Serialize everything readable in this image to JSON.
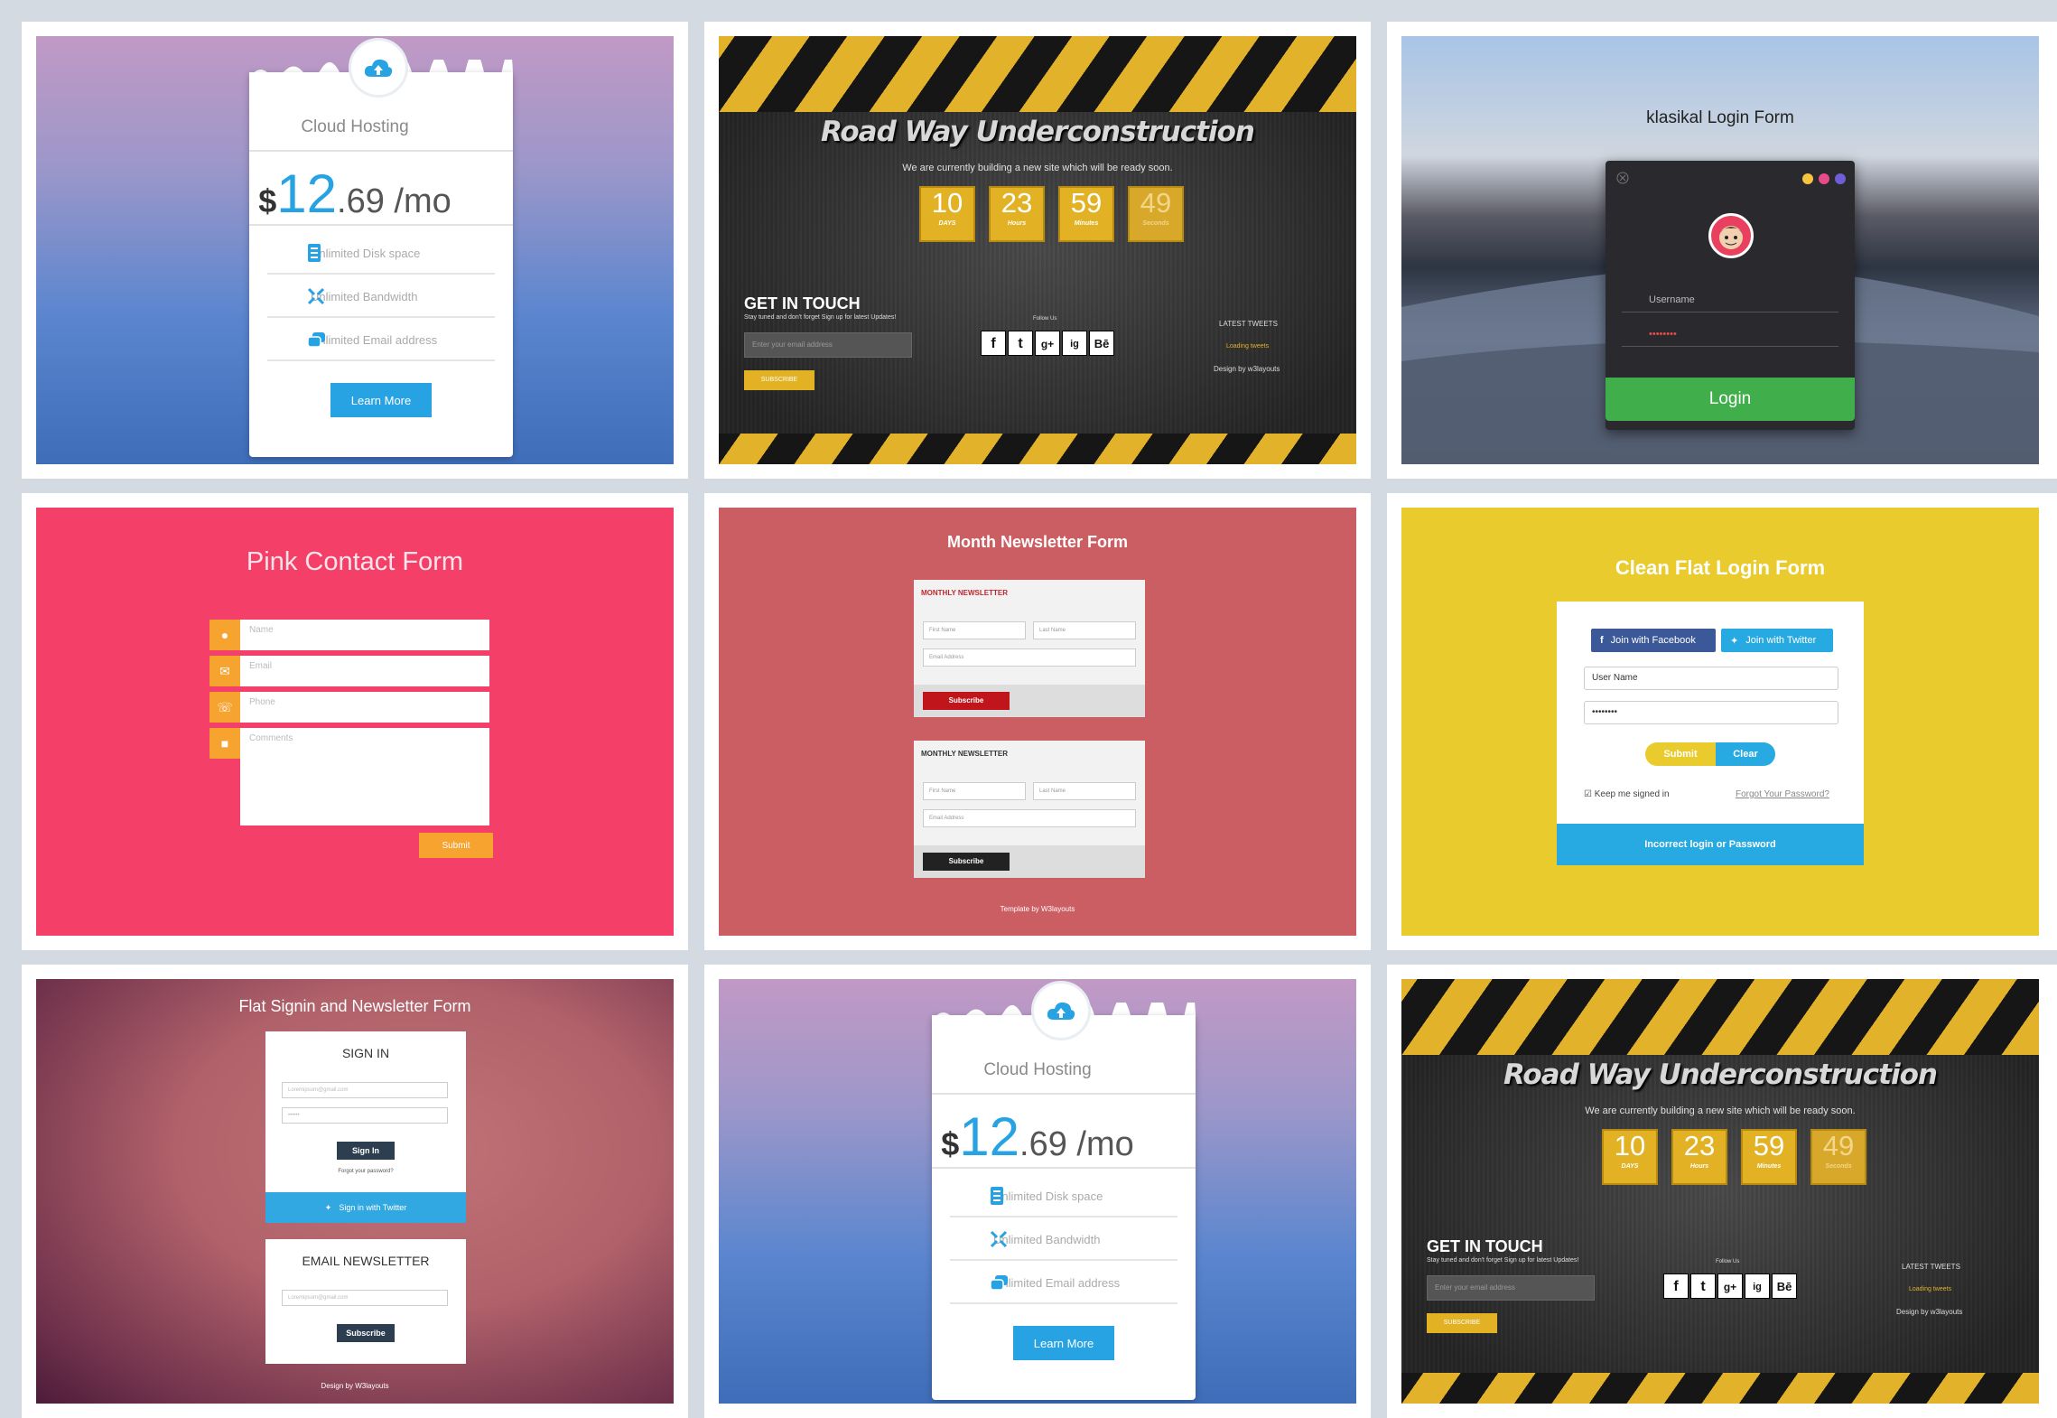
{
  "cloud_hosting": {
    "title": "Cloud Hosting",
    "price_currency": "$",
    "price_major": "12",
    "price_minor": ".69 /mo",
    "features": [
      "Unlimited Disk space",
      "Unlimited Bandwidth",
      "Unlimited Email address"
    ],
    "button": "Learn More",
    "accent": "#27a3e4"
  },
  "construction": {
    "title": "Road Way Underconstruction",
    "subtitle": "We are currently building a new site which will be ready soon.",
    "countdown": [
      {
        "value": "10",
        "label": "DAYS"
      },
      {
        "value": "23",
        "label": "Hours"
      },
      {
        "value": "59",
        "label": "Minutes"
      },
      {
        "value": "49",
        "label": "Seconds"
      }
    ],
    "get_in_touch": "GET IN TOUCH",
    "get_in_touch_sub": "Stay tuned and don't forget Sign up for latest Updates!",
    "email_placeholder": "Enter your email address",
    "subscribe": "SUBSCRIBE",
    "follow": "Follow Us",
    "social": [
      "f",
      "t",
      "g+",
      "ig",
      "Bē"
    ],
    "latest_tweets": "LATEST TWEETS",
    "loading": "Loading tweets",
    "design_credit": "Design by w3layouts"
  },
  "klasikal": {
    "title": "klasikal Login Form",
    "username_placeholder": "Username",
    "password_value": "••••••••",
    "button": "Login"
  },
  "pink_contact": {
    "title": "Pink Contact Form",
    "fields": [
      "Name",
      "Email",
      "Phone",
      "Comments"
    ],
    "submit": "Submit"
  },
  "newsletter": {
    "title": "Month Newsletter Form",
    "card_heading": "MONTHLY NEWSLETTER",
    "first_name": "First Name",
    "last_name": "Last Name",
    "email": "Email Address",
    "subscribe": "Subscribe",
    "credit": "Template by W3layouts"
  },
  "clean_flat": {
    "title": "Clean Flat Login Form",
    "facebook": "Join with Facebook",
    "twitter": "Join with Twitter",
    "username": "User Name",
    "password": "••••••••",
    "submit": "Submit",
    "clear": "Clear",
    "keep": "Keep me signed in",
    "forgot": "Forgot Your Password?",
    "error": "Incorrect login or Password"
  },
  "flat_signin": {
    "title": "Flat Signin and Newsletter Form",
    "sign_in_heading": "SIGN IN",
    "email_placeholder": "Loremipsum@gmail.com",
    "password_placeholder": "••••••",
    "sign_in_button": "Sign In",
    "forgot": "Forgot your password?",
    "twitter": "Sign in with Twitter",
    "newsletter_heading": "EMAIL NEWSLETTER",
    "subscribe": "Subscribe",
    "credit": "Design by W3layouts"
  }
}
